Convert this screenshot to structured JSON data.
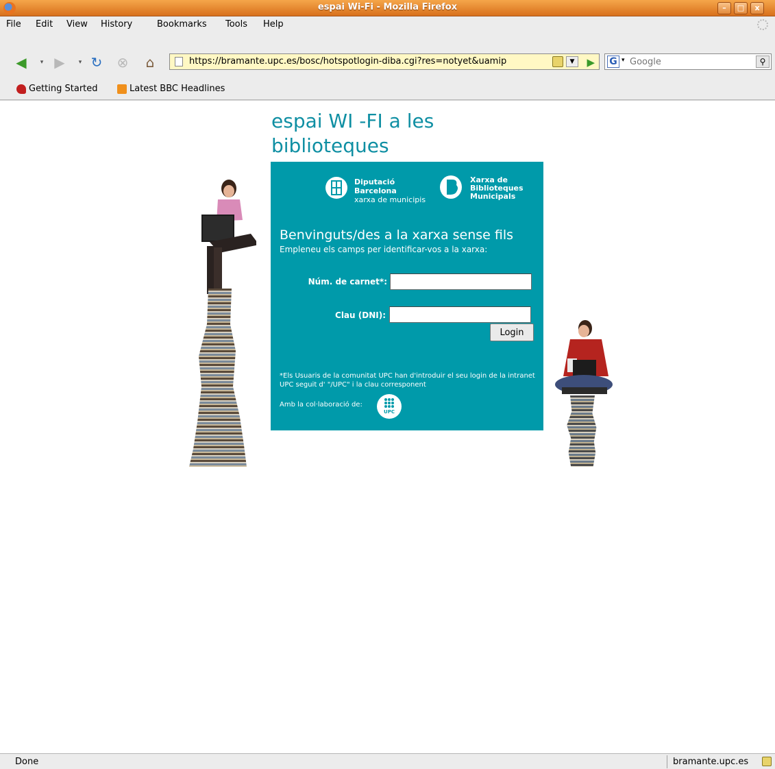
{
  "window": {
    "title": "espai Wi-Fi - Mozilla Firefox",
    "controls": [
      "–",
      "□",
      "x"
    ]
  },
  "menu": {
    "items": [
      "File",
      "Edit",
      "View",
      "History",
      "Bookmarks",
      "Tools",
      "Help"
    ]
  },
  "nav": {
    "url": "https://bramante.upc.es/bosc/hotspotlogin-diba.cgi?res=notyet&uamip",
    "search_placeholder": "Google"
  },
  "bookmarks": {
    "items": [
      "Getting Started",
      "Latest BBC Headlines"
    ]
  },
  "page": {
    "title": "espai WI -FI a les biblioteques",
    "logo_diputacio": [
      "Diputació",
      "Barcelona",
      "xarxa de municipis"
    ],
    "logo_xarxa": [
      "Xarxa de",
      "Biblioteques",
      "Municipals"
    ],
    "welcome": "Benvinguts/des a la xarxa sense fils",
    "instructions": "Empleneu els camps per identificar-vos a la xarxa:",
    "form": {
      "carnet_label": "Núm. de carnet*:",
      "carnet_value": "",
      "dni_label": "Clau (DNI):",
      "dni_value": "",
      "login_label": "Login"
    },
    "footnote": "*Els Usuaris de la comunitat UPC han d'introduir el seu login de la intranet UPC seguit d' \"/UPC\" i la clau corresponent",
    "collab_text": "Amb la col·laboració de:",
    "upc_logo_text": "UPC"
  },
  "status": {
    "text": "Done",
    "host": "bramante.upc.es"
  },
  "colors": {
    "panel": "#009aaa",
    "title": "#0f8fa3",
    "titlebar": "#e38a3c"
  }
}
